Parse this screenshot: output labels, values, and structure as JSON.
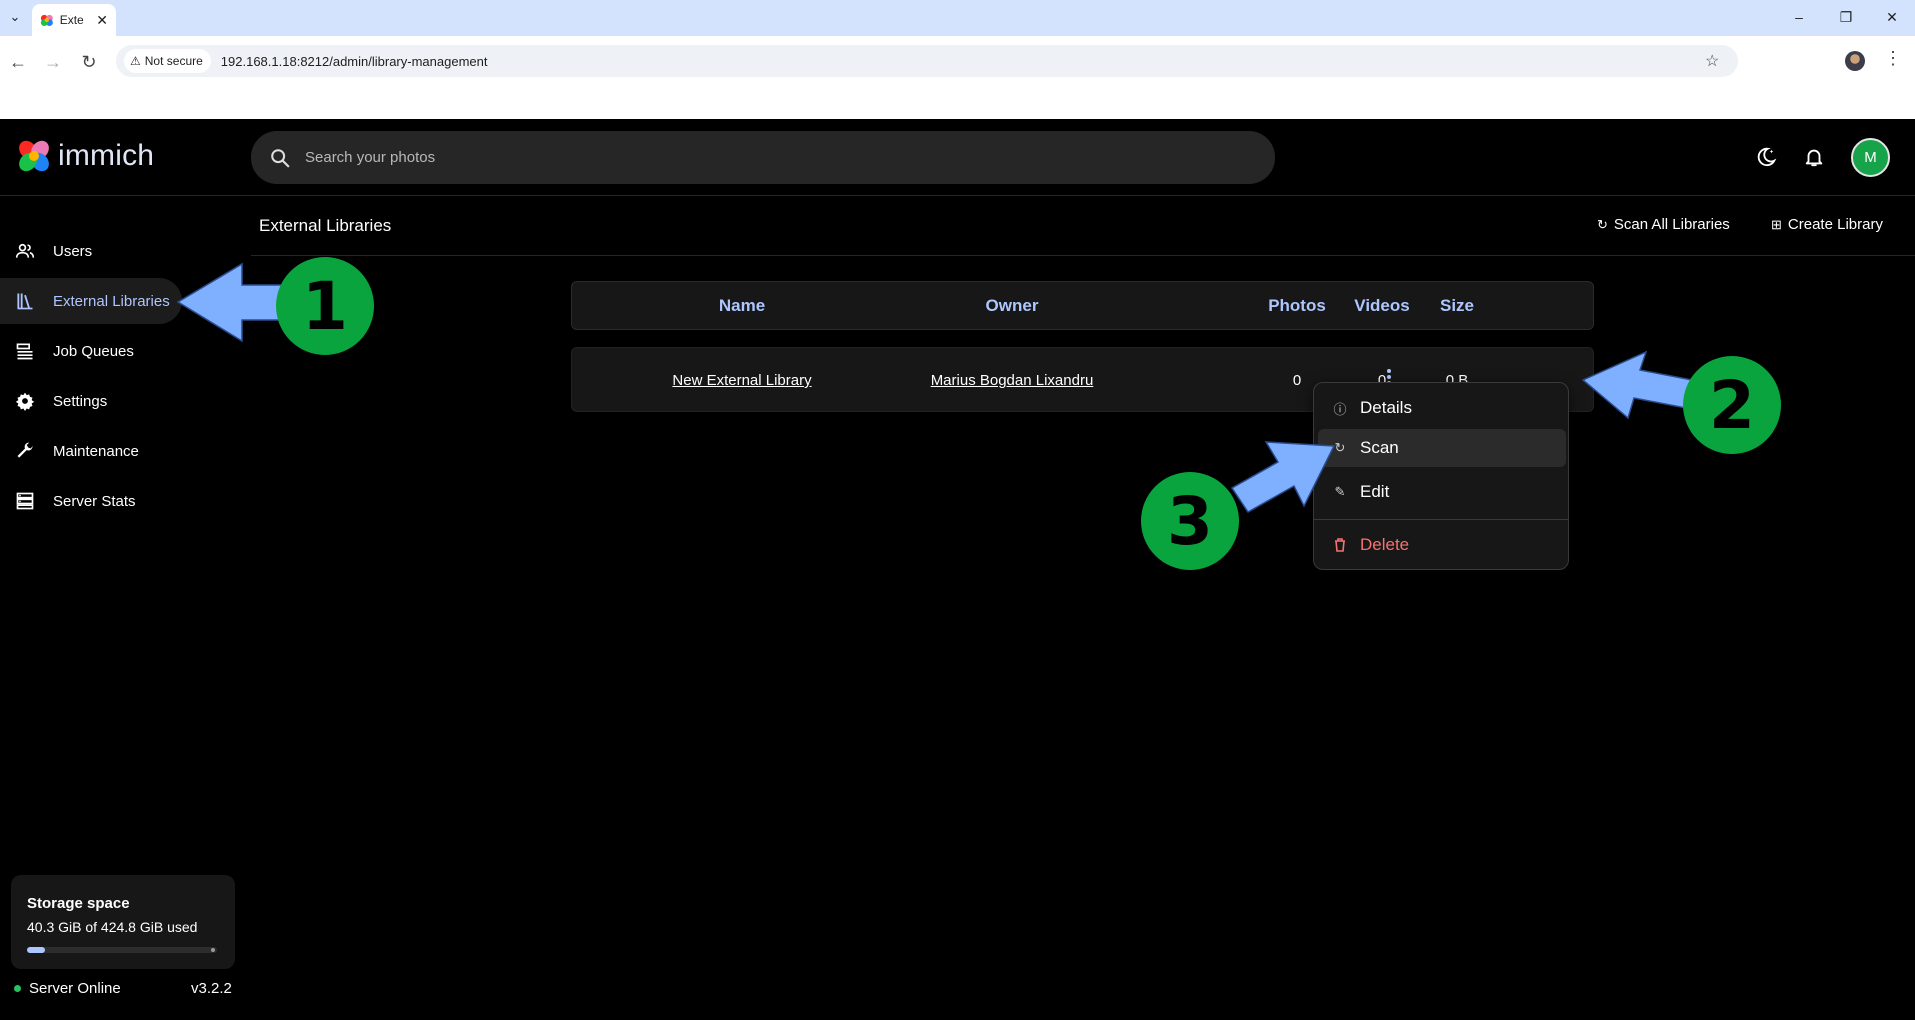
{
  "browser": {
    "tab_title": "Exte",
    "not_secure_label": "Not secure",
    "url_host": "192.168.1.18",
    "url_port_path": ":8212/admin/library-management"
  },
  "app": {
    "logo_text": "immich",
    "search_placeholder": "Search your photos",
    "avatar_initial": "M"
  },
  "sidebar": {
    "items": [
      {
        "label": "Users",
        "icon": "users-icon"
      },
      {
        "label": "External Libraries",
        "icon": "library-icon",
        "active": true
      },
      {
        "label": "Job Queues",
        "icon": "queue-icon"
      },
      {
        "label": "Settings",
        "icon": "gear-icon"
      },
      {
        "label": "Maintenance",
        "icon": "wrench-icon"
      },
      {
        "label": "Server Stats",
        "icon": "server-icon"
      }
    ]
  },
  "page": {
    "title": "External Libraries",
    "scan_all_label": "Scan All Libraries",
    "create_label": "Create Library"
  },
  "table": {
    "headers": [
      "Name",
      "Owner",
      "Photos",
      "Videos",
      "Size"
    ],
    "rows": [
      {
        "name": "New External Library",
        "owner": "Marius Bogdan Lixandru",
        "photos": "0",
        "videos": "0",
        "size": "0 B"
      }
    ]
  },
  "context_menu": {
    "items": [
      {
        "label": "Details",
        "icon": "info-icon"
      },
      {
        "label": "Scan",
        "icon": "refresh-icon"
      },
      {
        "label": "Edit",
        "icon": "pencil-icon"
      },
      {
        "label": "Delete",
        "icon": "trash-icon"
      }
    ]
  },
  "storage": {
    "title": "Storage space",
    "usage": "40.3 GiB of 424.8 GiB used",
    "used_fraction": 0.095
  },
  "footer": {
    "status": "Server Online",
    "version": "v3.2.2"
  },
  "annotations": [
    "1",
    "2",
    "3"
  ],
  "colors": {
    "accent": "#adc6ff",
    "annotation_arrow": "#7fb0ff",
    "annotation_circle": "#0aa43e",
    "danger": "#f87171",
    "online": "#22c55e"
  }
}
